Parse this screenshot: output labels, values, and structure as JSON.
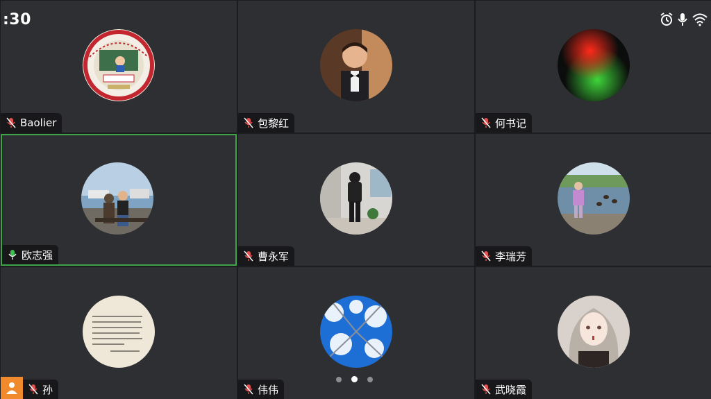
{
  "status_bar": {
    "time": ":30"
  },
  "colors": {
    "tile_bg": "#2e2f32",
    "active_border": "#3fa34a",
    "host_badge": "#f08a2c",
    "muted_mic": "#e05252",
    "active_mic": "#3fbf4f"
  },
  "participants": [
    {
      "name": "Baolier",
      "mic": "muted",
      "avatar": "school-emblem"
    },
    {
      "name": "包黎红",
      "mic": "muted",
      "avatar": "child-photo"
    },
    {
      "name": "何书记",
      "mic": "muted",
      "avatar": "red-green-blur"
    },
    {
      "name": "欧志强",
      "mic": "active",
      "avatar": "seaside-photo"
    },
    {
      "name": "曹永军",
      "mic": "muted",
      "avatar": "hooded-person-photo"
    },
    {
      "name": "李瑞芳",
      "mic": "muted",
      "avatar": "lake-photo"
    },
    {
      "name": "孙",
      "mic": "muted",
      "avatar": "text-card",
      "host": true
    },
    {
      "name": "伟伟",
      "mic": "muted",
      "avatar": "snowy-trees"
    },
    {
      "name": "武晓霞",
      "mic": "muted",
      "avatar": "anime-girl"
    }
  ],
  "pagination": {
    "pages": 3,
    "current": 2
  }
}
